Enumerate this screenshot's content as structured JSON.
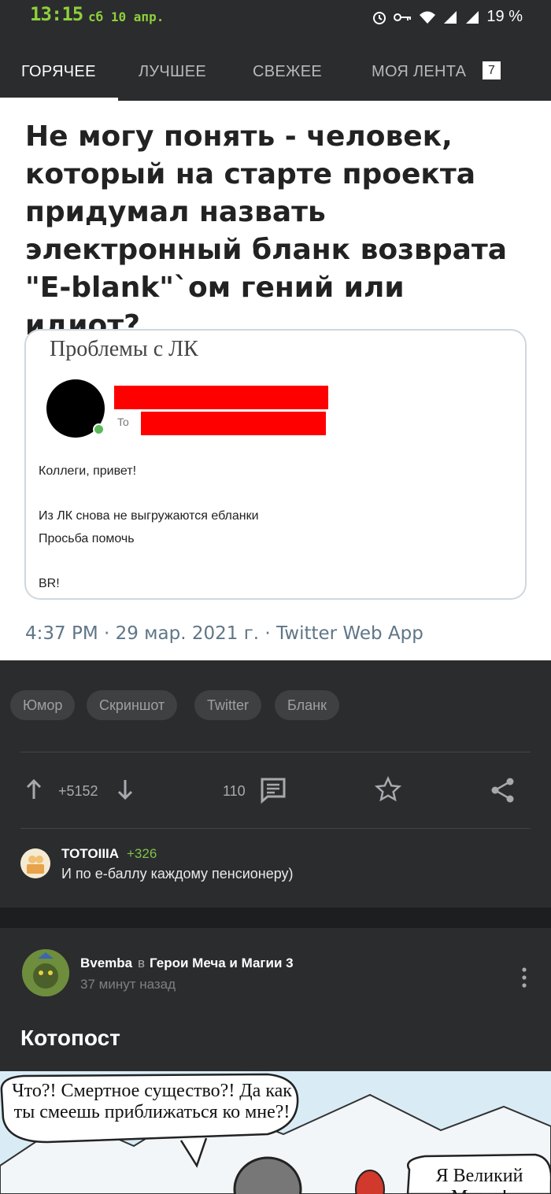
{
  "status_bar": {
    "time": "13:15",
    "date": "сб 10 апр.",
    "battery": "19 %"
  },
  "tabs": [
    {
      "label": "ГОРЯЧЕЕ",
      "active": true
    },
    {
      "label": "ЛУЧШЕЕ",
      "active": false
    },
    {
      "label": "СВЕЖЕЕ",
      "active": false
    },
    {
      "label": "МОЯ ЛЕНТА",
      "active": false,
      "badge": "7"
    }
  ],
  "post": {
    "title": "Не могу понять - человек, который на старте проекта придумал назвать электронный бланк возврата \"E-blank\"`ом гений или идиот?",
    "email_card": {
      "subject": "Проблемы с ЛК",
      "to_label": "To",
      "lines": [
        "Коллеги, привет!",
        "Из ЛК снова не выгружаются ебланки",
        "Просьба помочь",
        "BR!"
      ]
    },
    "meta": "4:37 PM · 29 мар. 2021 г. · Twitter Web App",
    "tags": [
      "Юмор",
      "Скриншот",
      "Twitter",
      "Бланк"
    ],
    "rating": "+5152",
    "comments_count": "110",
    "top_comment": {
      "author": "TOTOIIIA",
      "score": "+326",
      "text": "И по е-баллу каждому пенсионеру)"
    }
  },
  "post2": {
    "author": "Bvemba",
    "in": "в",
    "community": "Герои Меча и Магии 3",
    "time": "37 минут назад",
    "title": "Котопост",
    "comic_bubble_1": "Что?! Смертное существо?! Да как ты смеешь приближаться ко мне?!",
    "comic_bubble_2": "Я Великий Мааго!"
  },
  "icons": {
    "up": "arrow-up-icon",
    "down": "arrow-down-icon",
    "comments": "comment-icon",
    "save": "star-icon",
    "share": "share-icon",
    "menu": "more-vertical-icon"
  },
  "colors": {
    "accent_green": "#8ecf3a",
    "score_green": "#7ec24a",
    "background_dark": "#2b2c2e",
    "redaction": "#ff0000"
  }
}
